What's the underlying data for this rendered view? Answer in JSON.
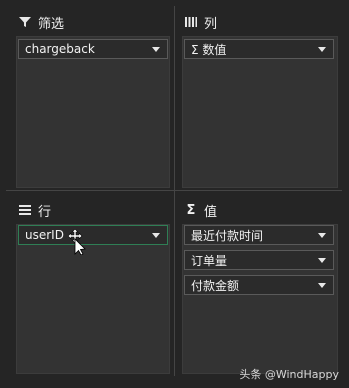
{
  "filters": {
    "title": "筛选",
    "fields": [
      "chargeback"
    ]
  },
  "columns": {
    "title": "列",
    "fields": [
      "Σ 数值"
    ]
  },
  "rows": {
    "title": "行",
    "fields": [
      "userID"
    ]
  },
  "values": {
    "title": "值",
    "fields": [
      "最近付款时间",
      "订单量",
      "付款金额"
    ]
  },
  "watermark": "头条 @WindHappy"
}
